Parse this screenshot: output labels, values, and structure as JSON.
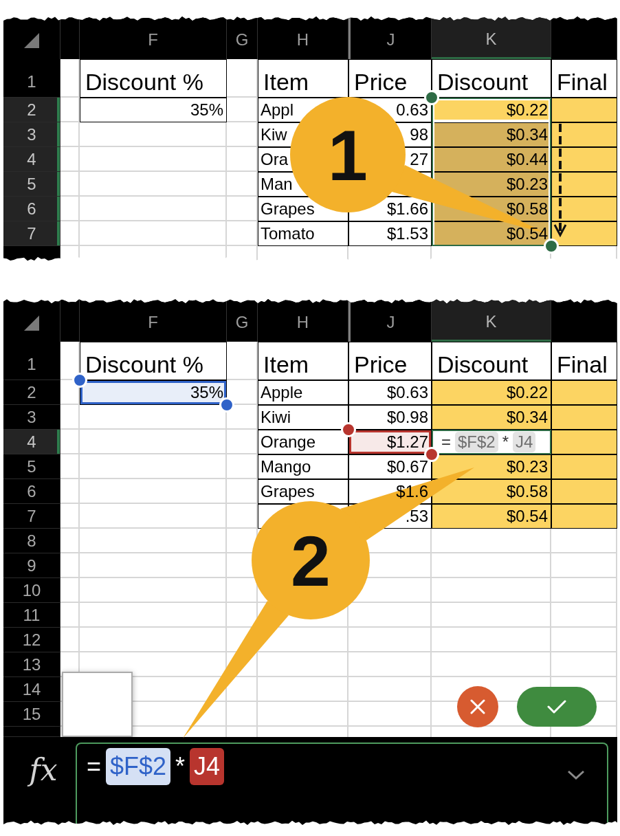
{
  "panels": [
    {
      "columns": [
        {
          "selected": false,
          "hidden_before": false
        },
        {
          "label": "F",
          "selected": false,
          "hidden_before": false
        },
        {
          "label": "G",
          "selected": false,
          "hidden_before": false
        },
        {
          "label": "H",
          "selected": false,
          "hidden_before": false
        },
        {
          "label": "J",
          "selected": false,
          "hidden_before": true
        },
        {
          "label": "K",
          "selected": true,
          "hidden_before": false
        },
        {
          "selected": false,
          "hidden_before": false
        }
      ],
      "rows": [
        {
          "number": "1",
          "selected": false,
          "cells": [
            {
              "kind": "blank"
            },
            {
              "kind": "heading",
              "text": "Discount %",
              "selected": false,
              "active": false,
              "bordered": true,
              "shaded": false
            },
            {
              "kind": "blank"
            },
            {
              "kind": "heading",
              "text": "Item",
              "selected": false,
              "active": false,
              "bordered": true,
              "shaded": false
            },
            {
              "kind": "heading",
              "text": "Price",
              "selected": false,
              "active": false,
              "bordered": true,
              "shaded": false
            },
            {
              "kind": "heading",
              "text": "Discount",
              "selected": false,
              "active": false,
              "bordered": true,
              "shaded": false
            },
            {
              "kind": "heading",
              "text": "Final",
              "selected": false,
              "active": false,
              "bordered": true,
              "shaded": false
            }
          ]
        },
        {
          "number": "2",
          "selected": true,
          "cells": [
            {
              "kind": "blank"
            },
            {
              "kind": "number",
              "text": "35%",
              "selected": false,
              "active": false,
              "bordered": true,
              "shaded": false
            },
            {
              "kind": "blank"
            },
            {
              "kind": "text",
              "text": "Appl",
              "selected": false,
              "active": false,
              "bordered": true,
              "shaded": false
            },
            {
              "kind": "number",
              "text": "0.63",
              "selected": false,
              "active": false,
              "bordered": true,
              "shaded": false
            },
            {
              "kind": "number",
              "text": "$0.22",
              "selected": true,
              "active": true,
              "bordered": true,
              "shaded": true
            },
            {
              "kind": "blank",
              "selected": false,
              "active": false,
              "bordered": true,
              "shaded": true
            }
          ]
        },
        {
          "number": "3",
          "selected": true,
          "cells": [
            {
              "kind": "blank"
            },
            {
              "kind": "blank"
            },
            {
              "kind": "blank"
            },
            {
              "kind": "text",
              "text": "Kiw",
              "selected": false,
              "active": false,
              "bordered": true,
              "shaded": false
            },
            {
              "kind": "number",
              "text": "98",
              "selected": false,
              "active": false,
              "bordered": true,
              "shaded": false
            },
            {
              "kind": "number",
              "text": "$0.34",
              "selected": true,
              "active": false,
              "bordered": true,
              "shaded": true
            },
            {
              "kind": "blank",
              "selected": false,
              "active": false,
              "bordered": true,
              "shaded": true
            }
          ]
        },
        {
          "number": "4",
          "selected": true,
          "cells": [
            {
              "kind": "blank"
            },
            {
              "kind": "blank"
            },
            {
              "kind": "blank"
            },
            {
              "kind": "text",
              "text": "Ora",
              "selected": false,
              "active": false,
              "bordered": true,
              "shaded": false
            },
            {
              "kind": "number",
              "text": "27",
              "selected": false,
              "active": false,
              "bordered": true,
              "shaded": false
            },
            {
              "kind": "number",
              "text": "$0.44",
              "selected": true,
              "active": false,
              "bordered": true,
              "shaded": true
            },
            {
              "kind": "blank",
              "selected": false,
              "active": false,
              "bordered": true,
              "shaded": true
            }
          ]
        },
        {
          "number": "5",
          "selected": true,
          "cells": [
            {
              "kind": "blank"
            },
            {
              "kind": "blank"
            },
            {
              "kind": "blank"
            },
            {
              "kind": "text",
              "text": "Man",
              "selected": false,
              "active": false,
              "bordered": true,
              "shaded": false
            },
            {
              "kind": "blank",
              "selected": false,
              "active": false,
              "bordered": true,
              "shaded": false
            },
            {
              "kind": "number",
              "text": "$0.23",
              "selected": true,
              "active": false,
              "bordered": true,
              "shaded": true
            },
            {
              "kind": "blank",
              "selected": false,
              "active": false,
              "bordered": true,
              "shaded": true
            }
          ]
        },
        {
          "number": "6",
          "selected": true,
          "cells": [
            {
              "kind": "blank"
            },
            {
              "kind": "blank"
            },
            {
              "kind": "blank"
            },
            {
              "kind": "text",
              "text": "Grapes",
              "selected": false,
              "active": false,
              "bordered": true,
              "shaded": false
            },
            {
              "kind": "number",
              "text": "$1.66",
              "selected": false,
              "active": false,
              "bordered": true,
              "shaded": false
            },
            {
              "kind": "number",
              "text": "$0.58",
              "selected": true,
              "active": false,
              "bordered": true,
              "shaded": true
            },
            {
              "kind": "blank",
              "selected": false,
              "active": false,
              "bordered": true,
              "shaded": true
            }
          ]
        },
        {
          "number": "7",
          "selected": true,
          "cells": [
            {
              "kind": "blank"
            },
            {
              "kind": "blank"
            },
            {
              "kind": "blank"
            },
            {
              "kind": "text",
              "text": "Tomato",
              "selected": false,
              "active": false,
              "bordered": true,
              "shaded": false
            },
            {
              "kind": "number",
              "text": "$1.53",
              "selected": false,
              "active": false,
              "bordered": true,
              "shaded": false
            },
            {
              "kind": "number",
              "text": "$0.54",
              "selected": true,
              "active": false,
              "bordered": true,
              "shaded": true
            },
            {
              "kind": "blank",
              "selected": false,
              "active": false,
              "bordered": true,
              "shaded": true
            }
          ]
        },
        {
          "selected": false
        }
      ],
      "callout": {
        "number": "1",
        "kind": "single"
      },
      "fill_down_arrow": true,
      "blank_pane": false
    },
    {
      "columns": [
        {
          "selected": false,
          "hidden_before": false
        },
        {
          "label": "F",
          "selected": false,
          "hidden_before": false
        },
        {
          "label": "G",
          "selected": false,
          "hidden_before": false
        },
        {
          "label": "H",
          "selected": false,
          "hidden_before": false
        },
        {
          "label": "J",
          "selected": false,
          "hidden_before": true
        },
        {
          "label": "K",
          "selected": true,
          "hidden_before": false
        },
        {
          "selected": false,
          "hidden_before": false
        }
      ],
      "rows": [
        {
          "number": "1",
          "selected": false,
          "cells": [
            {
              "kind": "blank"
            },
            {
              "kind": "heading",
              "text": "Discount %",
              "selected": false,
              "active": false,
              "bordered": true,
              "shaded": false
            },
            {
              "kind": "blank"
            },
            {
              "kind": "heading",
              "text": "Item",
              "selected": false,
              "active": false,
              "bordered": true,
              "shaded": false
            },
            {
              "kind": "heading",
              "text": "Price",
              "selected": false,
              "active": false,
              "bordered": true,
              "shaded": false
            },
            {
              "kind": "heading",
              "text": "Discount",
              "selected": false,
              "active": false,
              "bordered": true,
              "shaded": false
            },
            {
              "kind": "heading",
              "text": "Final",
              "selected": false,
              "active": false,
              "bordered": true,
              "shaded": false
            }
          ]
        },
        {
          "number": "2",
          "selected": false,
          "cells": [
            {
              "kind": "blank"
            },
            {
              "kind": "number",
              "text": "35%",
              "selected": false,
              "active": false,
              "bordered": true,
              "shaded": false,
              "color": "#2f62c8"
            },
            {
              "kind": "blank"
            },
            {
              "kind": "text",
              "text": "Apple",
              "selected": false,
              "active": false,
              "bordered": true,
              "shaded": false
            },
            {
              "kind": "number",
              "text": "$0.63",
              "selected": false,
              "active": false,
              "bordered": true,
              "shaded": false
            },
            {
              "kind": "number",
              "text": "$0.22",
              "selected": false,
              "active": false,
              "bordered": true,
              "shaded": true
            },
            {
              "kind": "blank",
              "selected": false,
              "active": false,
              "bordered": true,
              "shaded": true
            }
          ]
        },
        {
          "number": "3",
          "selected": false,
          "cells": [
            {
              "kind": "blank"
            },
            {
              "kind": "blank"
            },
            {
              "kind": "blank"
            },
            {
              "kind": "text",
              "text": "Kiwi",
              "selected": false,
              "active": false,
              "bordered": true,
              "shaded": false
            },
            {
              "kind": "number",
              "text": "$0.98",
              "selected": false,
              "active": false,
              "bordered": true,
              "shaded": false
            },
            {
              "kind": "number",
              "text": "$0.34",
              "selected": false,
              "active": false,
              "bordered": true,
              "shaded": true
            },
            {
              "kind": "blank",
              "selected": false,
              "active": false,
              "bordered": true,
              "shaded": true
            }
          ]
        },
        {
          "number": "4",
          "selected": true,
          "cells": [
            {
              "kind": "blank"
            },
            {
              "kind": "blank"
            },
            {
              "kind": "blank"
            },
            {
              "kind": "text",
              "text": "Orange",
              "selected": false,
              "active": false,
              "bordered": true,
              "shaded": false
            },
            {
              "kind": "number",
              "text": "$1.27",
              "selected": false,
              "active": false,
              "bordered": true,
              "shaded": false,
              "color": "#b8352e"
            },
            {
              "kind": "formula",
              "selected": false,
              "active": true,
              "bordered": true,
              "shaded": false,
              "tokens": [
                {
                  "text": "=",
                  "kind": "operator"
                },
                {
                  "text": "$F$2",
                  "kind": "reference"
                },
                {
                  "text": "*",
                  "kind": "operator"
                },
                {
                  "text": "J4",
                  "kind": "reference"
                }
              ]
            },
            {
              "kind": "blank",
              "selected": false,
              "active": false,
              "bordered": true,
              "shaded": true
            }
          ]
        },
        {
          "number": "5",
          "selected": false,
          "cells": [
            {
              "kind": "blank"
            },
            {
              "kind": "blank"
            },
            {
              "kind": "blank"
            },
            {
              "kind": "text",
              "text": "Mango",
              "selected": false,
              "active": false,
              "bordered": true,
              "shaded": false
            },
            {
              "kind": "number",
              "text": "$0.67",
              "selected": false,
              "active": false,
              "bordered": true,
              "shaded": false
            },
            {
              "kind": "number",
              "text": "$0.23",
              "selected": false,
              "active": false,
              "bordered": true,
              "shaded": true
            },
            {
              "kind": "blank",
              "selected": false,
              "active": false,
              "bordered": true,
              "shaded": true
            }
          ]
        },
        {
          "number": "6",
          "selected": false,
          "cells": [
            {
              "kind": "blank"
            },
            {
              "kind": "blank"
            },
            {
              "kind": "blank"
            },
            {
              "kind": "text",
              "text": "Grapes",
              "selected": false,
              "active": false,
              "bordered": true,
              "shaded": false
            },
            {
              "kind": "number",
              "text": "$1.6",
              "selected": false,
              "active": false,
              "bordered": true,
              "shaded": false
            },
            {
              "kind": "number",
              "text": "$0.58",
              "selected": false,
              "active": false,
              "bordered": true,
              "shaded": true
            },
            {
              "kind": "blank",
              "selected": false,
              "active": false,
              "bordered": true,
              "shaded": true
            }
          ]
        },
        {
          "number": "7",
          "selected": false,
          "cells": [
            {
              "kind": "blank"
            },
            {
              "kind": "blank"
            },
            {
              "kind": "blank"
            },
            {
              "kind": "blank",
              "selected": false,
              "active": false,
              "bordered": true,
              "shaded": false
            },
            {
              "kind": "number",
              "text": ".53",
              "selected": false,
              "active": false,
              "bordered": true,
              "shaded": false
            },
            {
              "kind": "number",
              "text": "$0.54",
              "selected": false,
              "active": false,
              "bordered": true,
              "shaded": true
            },
            {
              "kind": "blank",
              "selected": false,
              "active": false,
              "bordered": true,
              "shaded": true
            }
          ]
        },
        {
          "number": "8",
          "selected": false
        },
        {
          "number": "9",
          "selected": false
        },
        {
          "number": "10",
          "selected": false
        },
        {
          "number": "11",
          "selected": false
        },
        {
          "number": "12",
          "selected": false
        },
        {
          "number": "13",
          "selected": false
        },
        {
          "number": "14",
          "selected": false
        },
        {
          "number": "15",
          "selected": false
        },
        {
          "selected": false
        }
      ],
      "callout": {
        "number": "2",
        "kind": "double"
      },
      "fill_down_arrow": false,
      "blank_pane": true,
      "buttons": [
        {
          "kind": "cancel"
        },
        {
          "kind": "confirm"
        }
      ],
      "formula_bar": {
        "label": "fx",
        "tokens": [
          {
            "text": "=",
            "kind": "operator",
            "selected": false
          },
          {
            "text": "$F$2",
            "kind": "reference",
            "color": "#2f62c8",
            "selected": false
          },
          {
            "text": "*",
            "kind": "operator",
            "selected": false
          },
          {
            "text": "J4",
            "kind": "reference",
            "color": "#b8352e",
            "selected": true
          }
        ]
      }
    }
  ]
}
